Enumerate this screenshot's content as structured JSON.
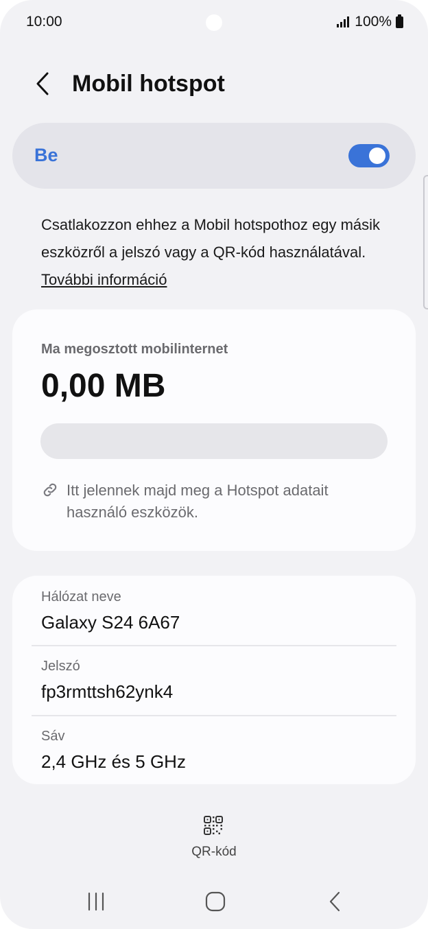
{
  "status_bar": {
    "time": "10:00",
    "battery_percent": "100%",
    "icons": [
      "signal-icon",
      "battery-icon"
    ]
  },
  "header": {
    "back_icon": "chevron-left-icon",
    "title": "Mobil hotspot"
  },
  "toggle": {
    "label": "Be",
    "state": "on",
    "accent_color": "#3a73d8"
  },
  "description": {
    "text": "Csatlakozzon ehhez a Mobil hotspothoz egy másik eszközről a jelszó vagy a QR-kód használatával. ",
    "link": "További információ"
  },
  "usage": {
    "label": "Ma megosztott mobilinternet",
    "value": "0,00 MB",
    "progress_fraction": 0,
    "devices_icon": "link-icon",
    "devices_note": "Itt jelennek majd meg a Hotspot adatait használó eszközök."
  },
  "network": {
    "name_label": "Hálózat neve",
    "name_value": "Galaxy S24 6A67",
    "password_label": "Jelszó",
    "password_value": "fp3rmttsh62ynk4",
    "band_label": "Sáv",
    "band_value": "2,4 GHz és 5 GHz"
  },
  "qr": {
    "icon": "qr-code-icon",
    "label": "QR-kód"
  },
  "nav_bar": {
    "icons": [
      "recent-apps-icon",
      "home-icon",
      "back-icon"
    ]
  }
}
